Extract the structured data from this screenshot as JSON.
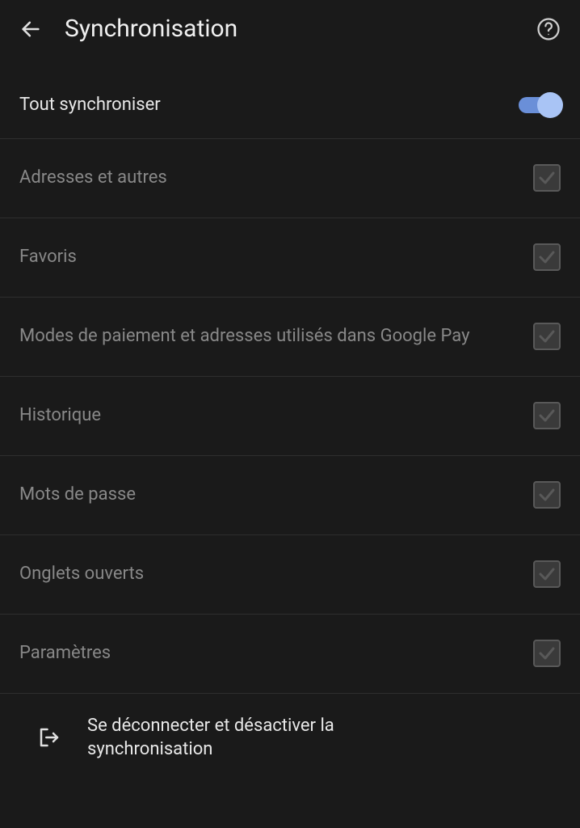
{
  "header": {
    "title": "Synchronisation"
  },
  "master": {
    "label": "Tout synchroniser",
    "enabled": true
  },
  "items": [
    {
      "label": "Adresses et autres",
      "checked": true
    },
    {
      "label": "Favoris",
      "checked": true
    },
    {
      "label": "Modes de paiement et adresses utilisés dans Google Pay",
      "checked": true
    },
    {
      "label": "Historique",
      "checked": true
    },
    {
      "label": "Mots de passe",
      "checked": true
    },
    {
      "label": "Onglets ouverts",
      "checked": true
    },
    {
      "label": "Paramètres",
      "checked": true
    }
  ],
  "signout": {
    "label": "Se déconnecter et désactiver la synchronisation"
  }
}
